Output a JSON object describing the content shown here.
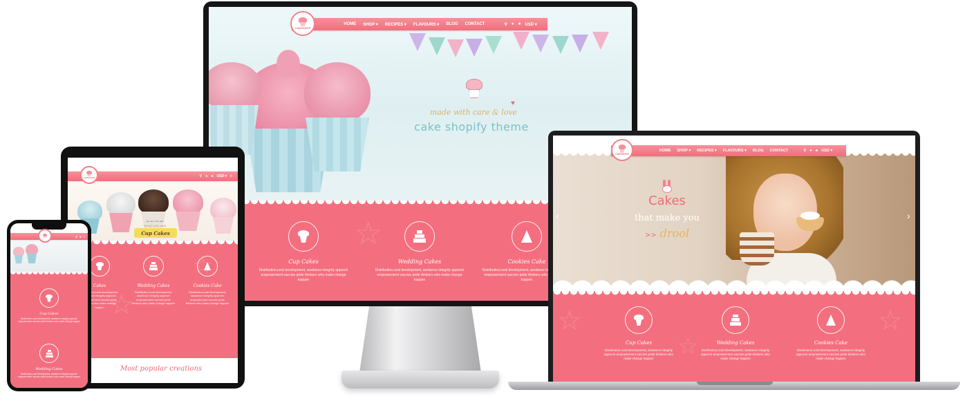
{
  "colors": {
    "brand_pink": "#f36f7f",
    "ribbon_pink": "#f27885",
    "title_teal": "#7ac2c4",
    "script_gold": "#d9b26b"
  },
  "brand": {
    "logo_text": "CAKESHOP"
  },
  "nav": {
    "home": "HOME",
    "shop": "SHOP",
    "recipes": "RECIPES",
    "flavours": "FLAVOURS",
    "blog": "BLOG",
    "contact": "CONTACT",
    "currency": "USD"
  },
  "monitor_hero": {
    "tagline": "made with care & love",
    "title": "cake shopify theme"
  },
  "laptop_hero": {
    "line1": "Cakes",
    "line2": "that make you",
    "line3": "drool"
  },
  "tablet_hero": {
    "small_text": "you can in the right",
    "script_text": "World with with",
    "title": "Cup Cakes"
  },
  "features": [
    {
      "title": "Cup Cakes",
      "icon": "cupcake-icon",
      "text": "Distribution,rural development, assitance integrity approch empowerment vaccies pride thinkers who make change happen"
    },
    {
      "title": "Wedding Cakes",
      "icon": "wedding-cake-icon",
      "text": "Distribution,rural development, assitance integrity approch empowerment vaccies pride thinkers who make change happen"
    },
    {
      "title": "Cookies Cake",
      "icon": "party-hat-icon",
      "text": "Distribution,rural development, assitance integrity approch empowerment vaccies pride thinkers who make change happen"
    }
  ],
  "tablet_features": [
    {
      "title": "Cakes",
      "text": "Distribution,rural development, assitance integrity approch empowerment vaccies pride thinkers who make change happen"
    },
    {
      "title": "Wedding Cakes",
      "text": "Distribution,rural development, assitance integrity approch empowerment vaccies pride thinkers who make change happen"
    },
    {
      "title": "Cookies Cake",
      "text": "Distribution,rural development, assitance integrity approch empowerment vaccies pride thinkers who make change happen"
    }
  ],
  "tablet_section": {
    "heading": "Most popular creations"
  },
  "phone_features": [
    {
      "title": "Cup Cakes",
      "text": "Distribution,rural development, assitance integrity approch empowerment vaccies pride thinkers who make change happen"
    },
    {
      "title": "Wedding Cakes",
      "text": "Distribution,rural development, assitance integrity approch empowerment vaccies pride thinkers who make change happen"
    }
  ]
}
